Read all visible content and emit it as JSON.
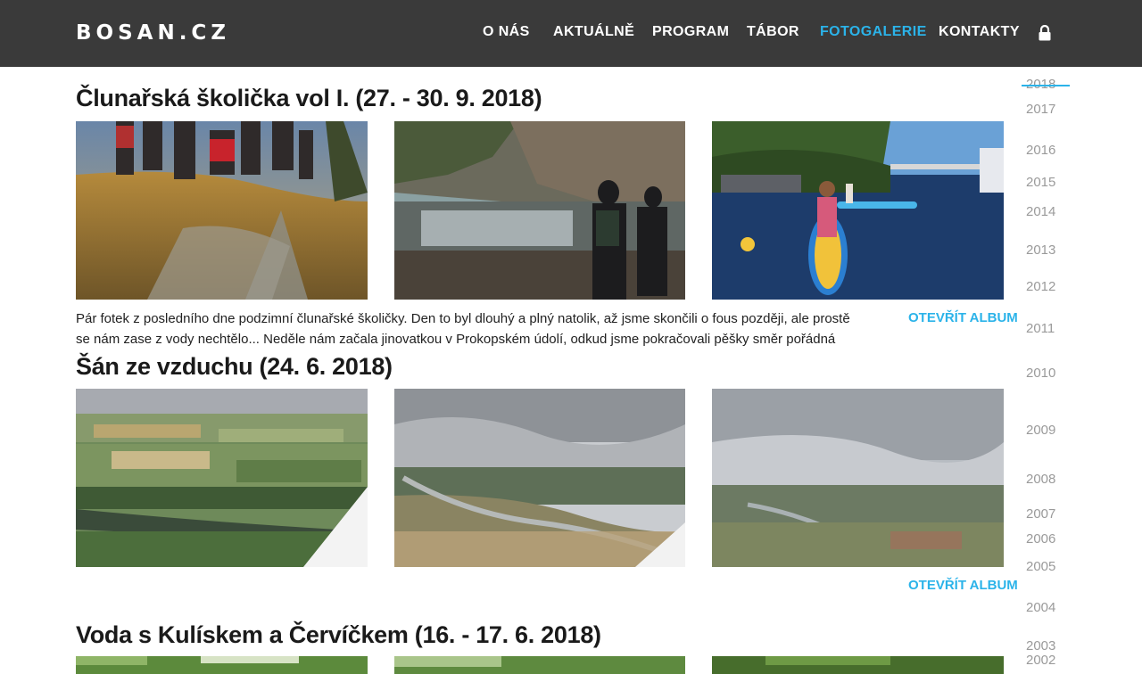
{
  "header": {
    "logo": "BOSAN.CZ",
    "nav": [
      {
        "label": "O NÁS",
        "active": false
      },
      {
        "label": "AKTUÁLNĚ",
        "active": false
      },
      {
        "label": "PROGRAM",
        "active": false
      },
      {
        "label": "TÁBOR",
        "active": false
      },
      {
        "label": "FOTOGALERIE",
        "active": true
      },
      {
        "label": "KONTAKTY",
        "active": false
      }
    ],
    "lock_icon": "lock-icon"
  },
  "colors": {
    "header_bg": "#3a3a3a",
    "accent": "#2bb3e9",
    "year_text": "#9a9a9a"
  },
  "timeline": {
    "current": "2018",
    "years": [
      "2018",
      "2017",
      "2016",
      "2015",
      "2014",
      "2013",
      "2012",
      "2011",
      "2010",
      "2009",
      "2008",
      "2007",
      "2006",
      "2005",
      "2004",
      "2003",
      "2002"
    ]
  },
  "albums": [
    {
      "title": "Člunařská školička vol I. (27. - 30. 9. 2018)",
      "description": "Pár fotek z posledního dne podzimní člunařské školičky. Den to byl dlouhý a plný natolik, až jsme skončili o fous později, ale prostě se nám zase z vody nechtělo... Neděle nám začala jinovatkou v Prokopském údolí, odkud jsme pokračovali pěšky směr pořádná snídaně na",
      "open_label": "OTEVŘÍT ALBUM",
      "photos": [
        "group-on-hill-sunset-photo",
        "quarry-lake-reflection-photo",
        "paddleboard-river-photo"
      ]
    },
    {
      "title": "Šán ze vzduchu (24. 6. 2018)",
      "description": "",
      "open_label": "OTEVŘÍT ALBUM",
      "photos": [
        "aerial-fields-river-photo",
        "aerial-cloudy-river-valley-photo",
        "aerial-overcast-landscape-photo"
      ]
    },
    {
      "title": "Voda s Kulískem a Červíčkem (16. - 17. 6. 2018)",
      "description": "",
      "open_label": "",
      "photos": [
        "treetops-photo-1",
        "treetops-photo-2",
        "treetops-photo-3"
      ]
    }
  ]
}
